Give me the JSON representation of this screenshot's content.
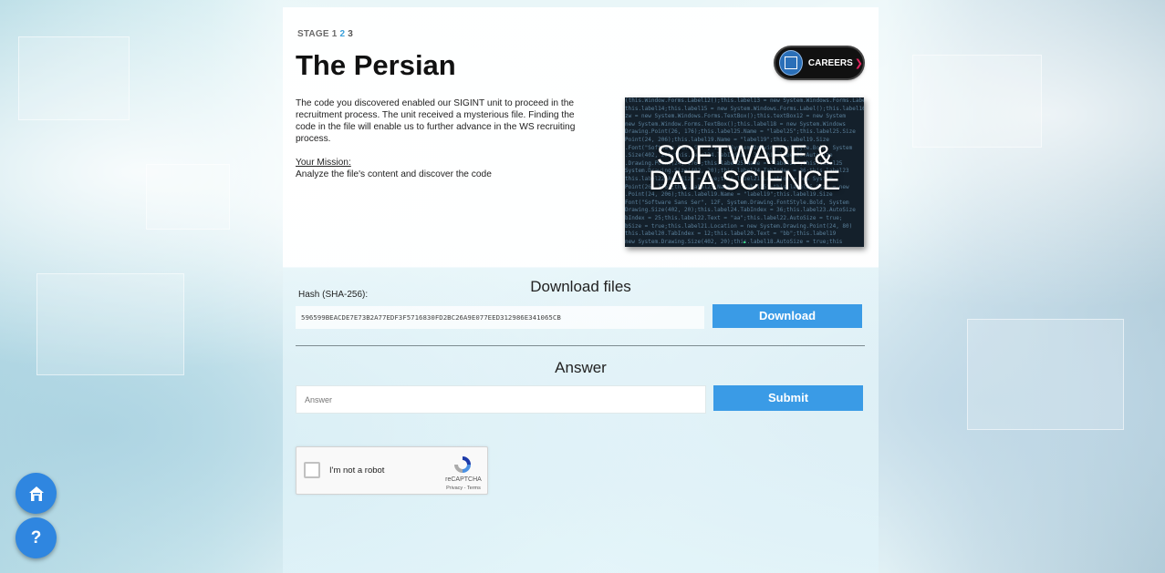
{
  "stages": {
    "prefix": "STAGE",
    "s1": "1",
    "s2": "2",
    "s3": "3"
  },
  "title": "The Persian",
  "careers_badge": {
    "label": "CAREERS",
    "arrow": "❯"
  },
  "intro": {
    "text": "The code you discovered enabled our SIGINT unit to proceed in the recruitment process. The unit received a mysterious file. Finding the code in the file will enable us to further advance in the WS recruiting process.",
    "mission_label": "Your Mission:",
    "mission_text": "Analyze the file's content and discover the code"
  },
  "promo": {
    "line1": "SOFTWARE &",
    "line2": "DATA SCIENCE"
  },
  "download": {
    "title": "Download files",
    "hash_label": "Hash (SHA-256):",
    "hash_value": "596599BEACDE7E73B2A77EDF3F5716830FD2BC26A9E077EED312986E341065CB",
    "button_label": "Download"
  },
  "answer": {
    "title": "Answer",
    "placeholder": "Answer",
    "submit_label": "Submit"
  },
  "recaptcha": {
    "label": "I'm not a robot",
    "brand": "reCAPTCHA",
    "terms": "Privacy - Terms"
  },
  "fab": {
    "help_label": "?"
  },
  "colors": {
    "accent": "#3a9be6",
    "fab": "#2f86e0",
    "active_stage": "#3aa0da"
  }
}
